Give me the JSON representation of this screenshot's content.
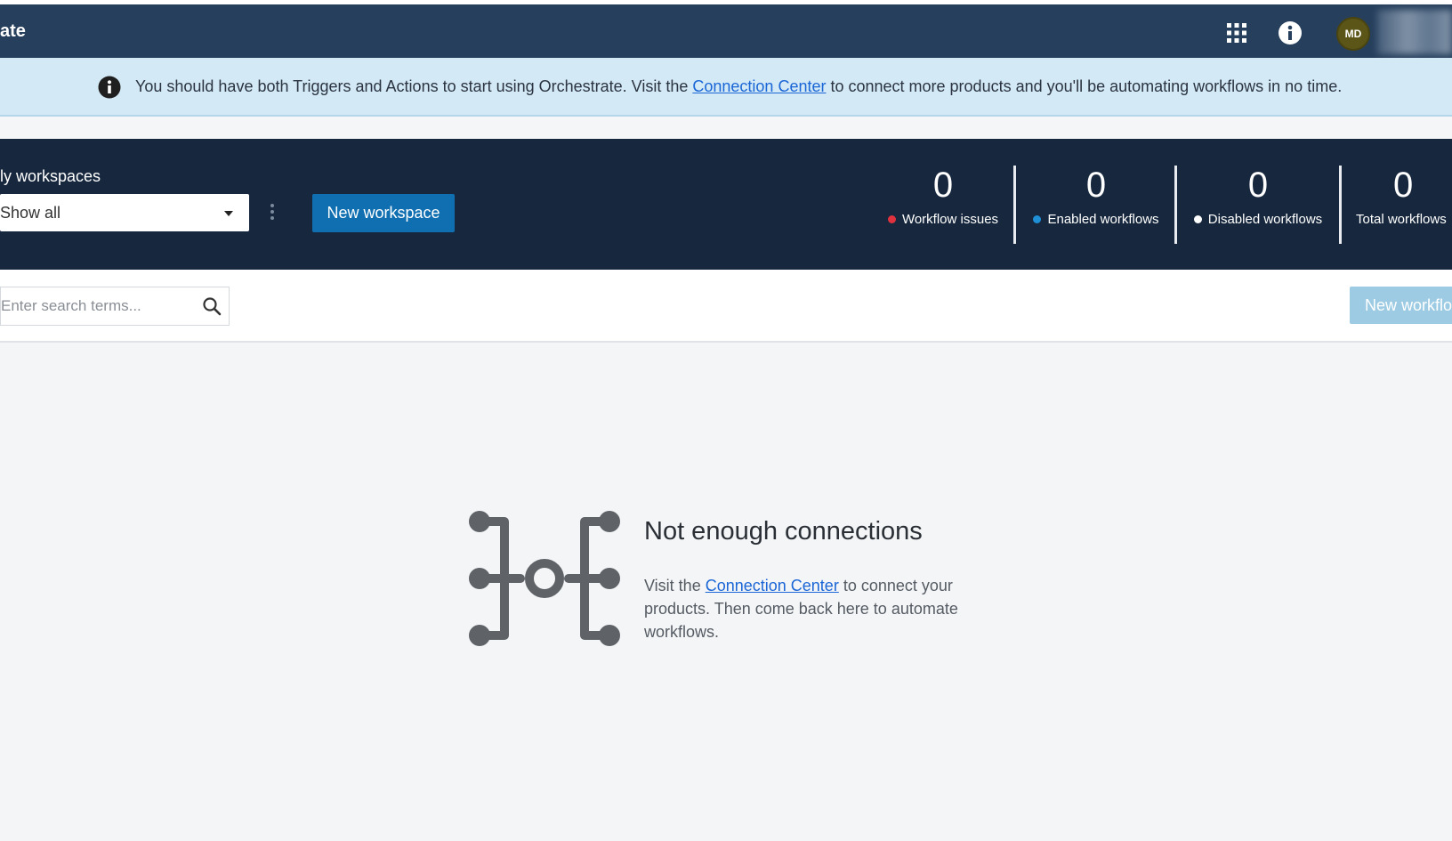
{
  "header": {
    "app_title": "ate",
    "icons": {
      "apps": "grid-icon",
      "info": "info-icon"
    },
    "avatar_initials": "MD"
  },
  "banner": {
    "text_before": "You should have both Triggers and Actions to start using Orchestrate. Visit the ",
    "link": "Connection Center",
    "text_after": " to connect more products and you'll be automating workflows in no time."
  },
  "workspaces": {
    "label": "ly workspaces",
    "select_value": "Show all",
    "new_button": "New workspace"
  },
  "stats": [
    {
      "value": "0",
      "label": "Workflow issues",
      "dot_color": "#e0323e"
    },
    {
      "value": "0",
      "label": "Enabled workflows",
      "dot_color": "#1f8fd6"
    },
    {
      "value": "0",
      "label": "Disabled workflows",
      "dot_color": "#ffffff"
    },
    {
      "value": "0",
      "label": "Total workflows",
      "dot_color": ""
    }
  ],
  "toolbar": {
    "search_placeholder": "Enter search terms...",
    "new_workflow_button": "New workflo"
  },
  "empty_state": {
    "title": "Not enough connections",
    "desc_before": "Visit the ",
    "desc_link": "Connection Center",
    "desc_after": " to connect your products. Then come back here to automate workflows."
  },
  "colors": {
    "topbar": "#263f5c",
    "banner": "#d3e9f6",
    "workspace_bar": "#17283e",
    "primary_button": "#0f6fb0",
    "disabled_button": "#9ccbe3",
    "link": "#1a66d6"
  }
}
